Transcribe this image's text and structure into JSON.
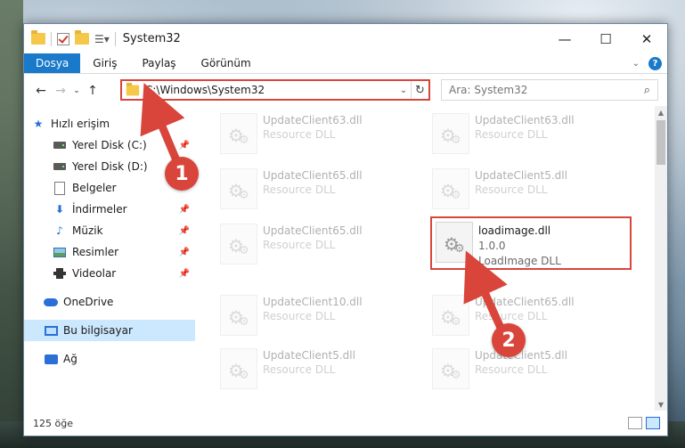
{
  "window": {
    "title": "System32",
    "controls": {
      "minimize": "—",
      "maximize": "☐",
      "close": "✕"
    }
  },
  "ribbon": {
    "tabs": [
      "Dosya",
      "Giriş",
      "Paylaş",
      "Görünüm"
    ]
  },
  "address": {
    "path": "C:\\Windows\\System32"
  },
  "search": {
    "placeholder": "Ara: System32"
  },
  "sidebar": {
    "items": [
      {
        "label": "Hızlı erişim",
        "icon": "star-icon"
      },
      {
        "label": "Yerel Disk (C:)",
        "icon": "drive-icon",
        "pinned": true
      },
      {
        "label": "Yerel Disk (D:)",
        "icon": "drive-icon"
      },
      {
        "label": "Belgeler",
        "icon": "documents-icon"
      },
      {
        "label": "İndirmeler",
        "icon": "downloads-icon",
        "pinned": true
      },
      {
        "label": "Müzik",
        "icon": "music-icon",
        "pinned": true
      },
      {
        "label": "Resimler",
        "icon": "pictures-icon",
        "pinned": true
      },
      {
        "label": "Videolar",
        "icon": "videos-icon",
        "pinned": true
      },
      {
        "label": "OneDrive",
        "icon": "onedrive-icon"
      },
      {
        "label": "Bu bilgisayar",
        "icon": "computer-icon",
        "selected": true
      },
      {
        "label": "Ağ",
        "icon": "network-icon"
      }
    ]
  },
  "files": [
    {
      "name": "UpdateClient63.dll",
      "desc": "Resource DLL"
    },
    {
      "name": "UpdateClient63.dll",
      "desc": "Resource DLL"
    },
    {
      "name": "UpdateClient65.dll",
      "desc": "Resource DLL"
    },
    {
      "name": "UpdateClient5.dll",
      "desc": "Resource DLL"
    },
    {
      "name": "UpdateClient65.dll",
      "desc": "Resource DLL"
    },
    {
      "name": "loadimage.dll",
      "version": "1.0.0",
      "desc": "LoadImage DLL"
    },
    {
      "name": "UpdateClient10.dll",
      "desc": "Resource DLL"
    },
    {
      "name": "UpdateClient65.dll",
      "desc": "Resource DLL"
    },
    {
      "name": "UpdateClient5.dll",
      "desc": "Resource DLL"
    },
    {
      "name": "UpdateClient5.dll",
      "desc": "Resource DLL"
    }
  ],
  "status": {
    "count": "125 öğe"
  },
  "annotations": {
    "step1": "1",
    "step2": "2",
    "color": "#d9453a"
  }
}
